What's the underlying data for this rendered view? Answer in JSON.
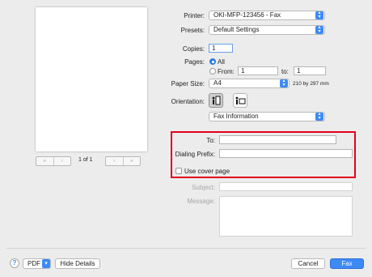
{
  "preview": {
    "nav_first": "«",
    "nav_prev": "‹",
    "page_indicator": "1 of 1",
    "nav_next": "›",
    "nav_last": "»"
  },
  "printer": {
    "label": "Printer:",
    "value": "OKI-MFP-123456 - Fax"
  },
  "presets": {
    "label": "Presets:",
    "value": "Default Settings"
  },
  "copies": {
    "label": "Copies:",
    "value": "1"
  },
  "pages": {
    "label": "Pages:",
    "all_label": "All",
    "from_label": "From:",
    "from_value": "1",
    "to_label": "to:",
    "to_value": "1",
    "selected": "all"
  },
  "paper_size": {
    "label": "Paper Size:",
    "value": "A4",
    "dimensions": "210 by 297 mm"
  },
  "orientation": {
    "label": "Orientation:",
    "selected": "portrait"
  },
  "section": {
    "value": "Fax Information"
  },
  "fax": {
    "to_label": "To:",
    "to_value": "",
    "dialing_prefix_label": "Dialing Prefix:",
    "dialing_prefix_value": "",
    "cover_page_label": "Use cover page",
    "cover_page_checked": false,
    "subject_label": "Subject:",
    "message_label": "Message:"
  },
  "footer": {
    "help": "?",
    "pdf_label": "PDF",
    "hide_details": "Hide Details",
    "cancel": "Cancel",
    "fax": "Fax"
  },
  "colors": {
    "accent": "#3d8af7",
    "highlight_border": "#e3001b"
  },
  "icons": {
    "popup_arrows": "updown-chevron-icon",
    "portrait": "portrait-orientation-icon",
    "landscape": "landscape-orientation-icon",
    "help": "question-icon",
    "pdf_menu": "chevron-down-icon"
  }
}
